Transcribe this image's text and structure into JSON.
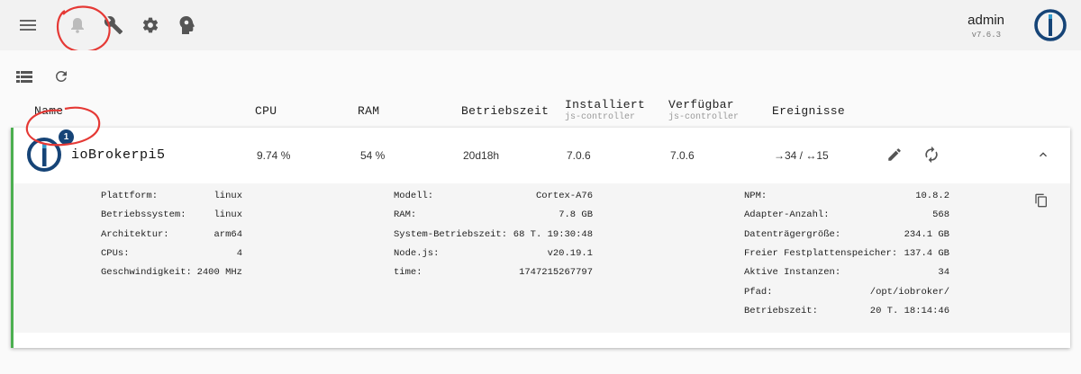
{
  "topbar": {
    "user": "admin",
    "version": "v7.6.3",
    "icons": [
      "menu-icon",
      "bell-icon",
      "wrench-icon",
      "gear-icon",
      "head-icon"
    ]
  },
  "toolbar": {
    "icons": [
      "list-view-icon",
      "refresh-icon"
    ]
  },
  "columns": {
    "name": "Name",
    "cpu": "CPU",
    "ram": "RAM",
    "uptime": "Betriebszeit",
    "installed": "Installiert",
    "installed_sub": "js-controller",
    "available": "Verfügbar",
    "available_sub": "js-controller",
    "events": "Ereignisse"
  },
  "host": {
    "name": "ioBrokerpi5",
    "badge": "1",
    "cpu": "9.74 %",
    "ram": "54 %",
    "uptime": "20d18h",
    "installed": "7.0.6",
    "available": "7.0.6",
    "events": "→34 / ↔15",
    "status_color": "#4caf50"
  },
  "details": {
    "col1": [
      {
        "label": "Plattform:",
        "value": "linux"
      },
      {
        "label": "Betriebssystem:",
        "value": "linux"
      },
      {
        "label": "Architektur:",
        "value": "arm64"
      },
      {
        "label": "CPUs:",
        "value": "4"
      },
      {
        "label": "Geschwindigkeit:",
        "value": "2400 MHz"
      }
    ],
    "col2": [
      {
        "label": "Modell:",
        "value": "Cortex-A76"
      },
      {
        "label": "RAM:",
        "value": "7.8 GB"
      },
      {
        "label": "System-Betriebszeit:",
        "value": "68 T. 19:30:48"
      },
      {
        "label": "Node.js:",
        "value": "v20.19.1"
      },
      {
        "label": "time:",
        "value": "1747215267797"
      }
    ],
    "col3": [
      {
        "label": "NPM:",
        "value": "10.8.2"
      },
      {
        "label": "Adapter-Anzahl:",
        "value": "568"
      },
      {
        "label": "Datenträgergröße:",
        "value": "234.1 GB"
      },
      {
        "label": "Freier Festplattenspeicher:",
        "value": "137.4 GB"
      },
      {
        "label": "Aktive Instanzen:",
        "value": "34"
      },
      {
        "label": "Pfad:",
        "value": "/opt/iobroker/"
      },
      {
        "label": "Betriebszeit:",
        "value": "20 T. 18:14:46"
      }
    ]
  },
  "colors": {
    "accent": "#164477",
    "annotation": "#e53935"
  }
}
